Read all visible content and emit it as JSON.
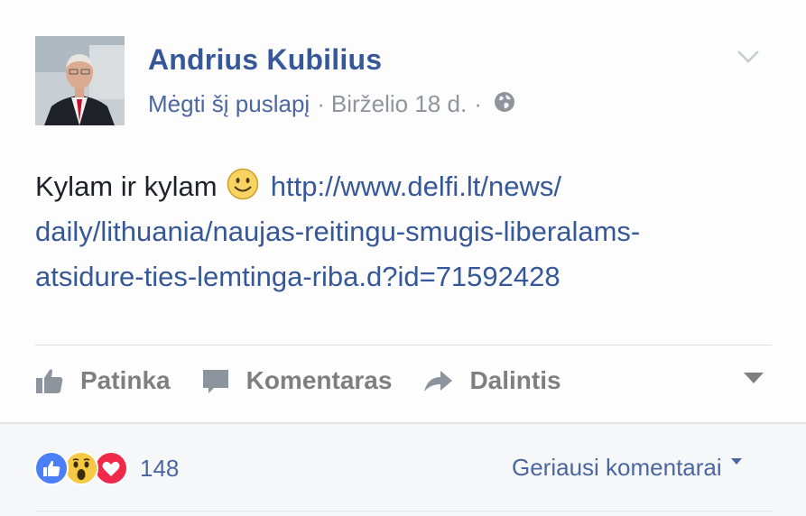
{
  "post": {
    "author": "Andrius Kubilius",
    "like_page": "Mėgti šį puslapį",
    "separator": "·",
    "date": "Birželio 18 d.",
    "text": "Kylam ir kylam",
    "link_line1": "http://www.delfi.lt/news/",
    "link_line2": "daily/lithuania/naujas-reitingu-smugis-liberalams-",
    "link_line3": "atsidure-ties-lemtinga-riba.d?id=71592428"
  },
  "actions": {
    "like": "Patinka",
    "comment": "Komentaras",
    "share": "Dalintis"
  },
  "footer": {
    "reaction_count": "148",
    "comments_sort": "Geriausi komentarai"
  },
  "icons": {
    "privacy": "globe-icon",
    "options": "chevron-down-icon",
    "like": "thumbs-up-icon",
    "comment": "speech-bubble-icon",
    "share": "share-arrow-icon",
    "reactions": [
      "like-reaction-icon",
      "wow-reaction-icon",
      "love-reaction-icon"
    ]
  },
  "colors": {
    "link": "#365899",
    "meta": "#90949c",
    "action": "#7f7f7f",
    "like_reaction": "#4a7ff7",
    "wow_reaction": "#f6c844",
    "love_reaction": "#f0284a"
  }
}
